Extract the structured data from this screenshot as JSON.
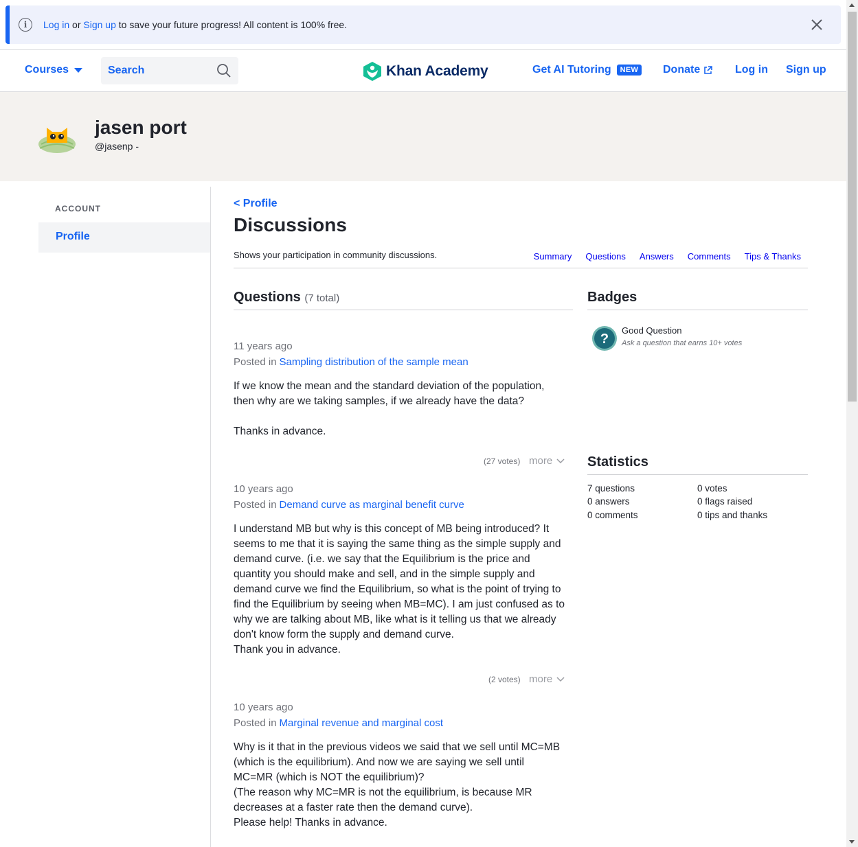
{
  "banner": {
    "login": "Log in",
    "or": "or",
    "signup": "Sign up",
    "rest": "to save your future progress! All content is 100% free."
  },
  "header": {
    "courses": "Courses",
    "search_placeholder": "Search",
    "logo": "Khan Academy",
    "ai_tutoring": "Get AI Tutoring",
    "new_badge": "NEW",
    "donate": "Donate",
    "login": "Log in",
    "signup": "Sign up"
  },
  "profile": {
    "name": "jasen port",
    "handle": "@jasenp -"
  },
  "sidebar": {
    "section": "ACCOUNT",
    "item": "Profile"
  },
  "main": {
    "back": "< Profile",
    "title": "Discussions",
    "subtitle": "Shows your participation in community discussions.",
    "tabs": [
      "Summary",
      "Questions",
      "Answers",
      "Comments",
      "Tips & Thanks"
    ],
    "questions_heading": "Questions",
    "questions_total": "(7 total)",
    "posted_in": "Posted in",
    "more": "more",
    "questions": [
      {
        "age": "11 years ago",
        "topic": "Sampling distribution of the sample mean",
        "body": "If we know the mean and the standard deviation of the population,\nthen why are we taking samples, if we already have the data?\n\nThanks in advance.",
        "votes": "(27 votes)"
      },
      {
        "age": "10 years ago",
        "topic": "Demand curve as marginal benefit curve",
        "body": "I understand MB but why is this concept of MB being introduced? It\nseems to me that it is saying the same thing as the simple supply and\ndemand curve. (i.e. we say that the Equilibrium is the price and\nquantity you should make and sell, and in the simple supply and\ndemand curve we find the Equilibrium, so what is the point of trying to\nfind the Equilibrium by seeing when MB=MC). I am just confused as to\nwhy we are talking about MB, like what is it telling us that we already\ndon't know form the supply and demand curve.\nThank you in advance.",
        "votes": "(2 votes)"
      },
      {
        "age": "10 years ago",
        "topic": "Marginal revenue and marginal cost",
        "body": "Why is it that in the previous videos we said that we sell until MC=MB\n(which is the equilibrium). And now we are saying we sell until\nMC=MR (which is NOT the equilibrium)?\n(The reason why MC=MR is not the equilibrium, is because MR\ndecreases at a faster rate then the demand curve).\nPlease help! Thanks in advance."
      }
    ]
  },
  "badges": {
    "heading": "Badges",
    "items": [
      {
        "title": "Good Question",
        "desc": "Ask a question that earns 10+ votes"
      }
    ]
  },
  "statistics": {
    "heading": "Statistics",
    "left": [
      "7 questions",
      "0 answers",
      "0 comments"
    ],
    "right": [
      "0 votes",
      "0 flags raised",
      "0 tips and thanks"
    ]
  },
  "colors": {
    "accent": "#1865f2",
    "logo_green": "#14bf96",
    "band_bg": "#f4f2ef"
  }
}
